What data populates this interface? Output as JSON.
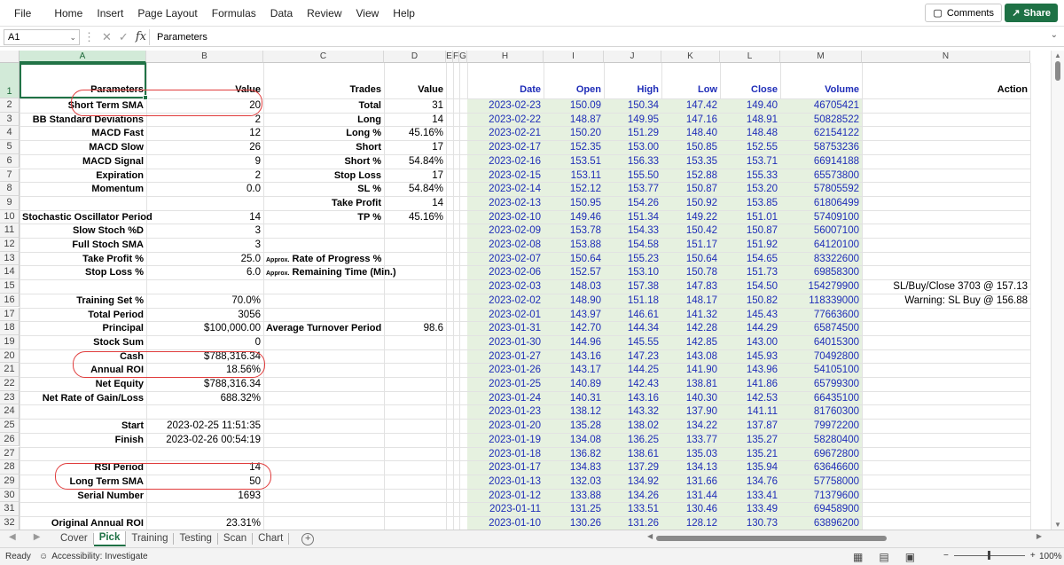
{
  "menu": [
    "File",
    "Home",
    "Insert",
    "Page Layout",
    "Formulas",
    "Data",
    "Review",
    "View",
    "Help"
  ],
  "comments_label": "Comments",
  "share_label": "Share",
  "formula_bar": {
    "name_box": "A1",
    "formula": "Parameters"
  },
  "columns": [
    "A",
    "B",
    "C",
    "D",
    "E",
    "F",
    "G",
    "H",
    "I",
    "J",
    "K",
    "L",
    "M",
    "N"
  ],
  "row_numbers": [
    "1",
    "2",
    "3",
    "4",
    "5",
    "6",
    "7",
    "8",
    "9",
    "10",
    "11",
    "12",
    "13",
    "14",
    "15",
    "16",
    "17",
    "18",
    "19",
    "20",
    "21",
    "22",
    "23",
    "24",
    "25",
    "26",
    "27",
    "28",
    "29",
    "30",
    "31",
    "32"
  ],
  "headers": {
    "parameters": "Parameters",
    "value": "Value",
    "trades": "Trades",
    "value2": "Value",
    "date": "Date",
    "open": "Open",
    "high": "High",
    "low": "Low",
    "close": "Close",
    "volume": "Volume",
    "action": "Action"
  },
  "params_a": [
    {
      "row": 2,
      "label": "Short Term SMA",
      "value": "20"
    },
    {
      "row": 3,
      "label": "BB Standard Deviations",
      "value": "2"
    },
    {
      "row": 4,
      "label": "MACD Fast",
      "value": "12"
    },
    {
      "row": 5,
      "label": "MACD Slow",
      "value": "26"
    },
    {
      "row": 6,
      "label": "MACD Signal",
      "value": "9"
    },
    {
      "row": 7,
      "label": "Expiration",
      "value": "2"
    },
    {
      "row": 8,
      "label": "Momentum",
      "value": "0.0"
    },
    {
      "row": 10,
      "label": "Stochastic Oscillator Period",
      "value": "14"
    },
    {
      "row": 11,
      "label": "Slow Stoch %D",
      "value": "3"
    },
    {
      "row": 12,
      "label": "Full Stoch SMA",
      "value": "3"
    },
    {
      "row": 13,
      "label": "Take Profit %",
      "value": "25.0"
    },
    {
      "row": 14,
      "label": "Stop Loss %",
      "value": "6.0"
    },
    {
      "row": 16,
      "label": "Training Set %",
      "value": "70.0%"
    },
    {
      "row": 17,
      "label": "Total Period",
      "value": "3056"
    },
    {
      "row": 18,
      "label": "Principal",
      "value": "$100,000.00"
    },
    {
      "row": 19,
      "label": "Stock Sum",
      "value": "0"
    },
    {
      "row": 20,
      "label": "Cash",
      "value": "$788,316.34"
    },
    {
      "row": 21,
      "label": "Annual ROI",
      "value": "18.56%"
    },
    {
      "row": 22,
      "label": "Net Equity",
      "value": "$788,316.34"
    },
    {
      "row": 23,
      "label": "Net Rate of Gain/Loss",
      "value": "688.32%"
    },
    {
      "row": 25,
      "label": "Start",
      "value": "2023-02-25 11:51:35"
    },
    {
      "row": 26,
      "label": "Finish",
      "value": "2023-02-26 00:54:19"
    },
    {
      "row": 28,
      "label": "RSI Period",
      "value": "14"
    },
    {
      "row": 29,
      "label": "Long Term SMA",
      "value": "50"
    },
    {
      "row": 30,
      "label": "Serial Number",
      "value": "1693"
    },
    {
      "row": 32,
      "label": "Original Annual ROI",
      "value": "23.31%"
    }
  ],
  "trades": [
    {
      "row": 2,
      "label": "Total",
      "value": "31"
    },
    {
      "row": 3,
      "label": "Long",
      "value": "14"
    },
    {
      "row": 4,
      "label": "Long %",
      "value": "45.16%"
    },
    {
      "row": 5,
      "label": "Short",
      "value": "17"
    },
    {
      "row": 6,
      "label": "Short %",
      "value": "54.84%"
    },
    {
      "row": 7,
      "label": "Stop Loss",
      "value": "17"
    },
    {
      "row": 8,
      "label": "SL %",
      "value": "54.84%"
    },
    {
      "row": 9,
      "label": "Take Profit",
      "value": "14"
    },
    {
      "row": 10,
      "label": "TP %",
      "value": "45.16%"
    },
    {
      "row": 18,
      "label": "Average Turnover Period",
      "value": "98.6"
    }
  ],
  "progress_labels": {
    "approx1": "Approx.",
    "rate": "Rate of Progress %",
    "approx2": "Approx.",
    "remaining": "Remaining Time (Min.)"
  },
  "prices": [
    [
      "2023-02-23",
      "150.09",
      "150.34",
      "147.42",
      "149.40",
      "46705421"
    ],
    [
      "2023-02-22",
      "148.87",
      "149.95",
      "147.16",
      "148.91",
      "50828522"
    ],
    [
      "2023-02-21",
      "150.20",
      "151.29",
      "148.40",
      "148.48",
      "62154122"
    ],
    [
      "2023-02-17",
      "152.35",
      "153.00",
      "150.85",
      "152.55",
      "58753236"
    ],
    [
      "2023-02-16",
      "153.51",
      "156.33",
      "153.35",
      "153.71",
      "66914188"
    ],
    [
      "2023-02-15",
      "153.11",
      "155.50",
      "152.88",
      "155.33",
      "65573800"
    ],
    [
      "2023-02-14",
      "152.12",
      "153.77",
      "150.87",
      "153.20",
      "57805592"
    ],
    [
      "2023-02-13",
      "150.95",
      "154.26",
      "150.92",
      "153.85",
      "61806499"
    ],
    [
      "2023-02-10",
      "149.46",
      "151.34",
      "149.22",
      "151.01",
      "57409100"
    ],
    [
      "2023-02-09",
      "153.78",
      "154.33",
      "150.42",
      "150.87",
      "56007100"
    ],
    [
      "2023-02-08",
      "153.88",
      "154.58",
      "151.17",
      "151.92",
      "64120100"
    ],
    [
      "2023-02-07",
      "150.64",
      "155.23",
      "150.64",
      "154.65",
      "83322600"
    ],
    [
      "2023-02-06",
      "152.57",
      "153.10",
      "150.78",
      "151.73",
      "69858300"
    ],
    [
      "2023-02-03",
      "148.03",
      "157.38",
      "147.83",
      "154.50",
      "154279900"
    ],
    [
      "2023-02-02",
      "148.90",
      "151.18",
      "148.17",
      "150.82",
      "118339000"
    ],
    [
      "2023-02-01",
      "143.97",
      "146.61",
      "141.32",
      "145.43",
      "77663600"
    ],
    [
      "2023-01-31",
      "142.70",
      "144.34",
      "142.28",
      "144.29",
      "65874500"
    ],
    [
      "2023-01-30",
      "144.96",
      "145.55",
      "142.85",
      "143.00",
      "64015300"
    ],
    [
      "2023-01-27",
      "143.16",
      "147.23",
      "143.08",
      "145.93",
      "70492800"
    ],
    [
      "2023-01-26",
      "143.17",
      "144.25",
      "141.90",
      "143.96",
      "54105100"
    ],
    [
      "2023-01-25",
      "140.89",
      "142.43",
      "138.81",
      "141.86",
      "65799300"
    ],
    [
      "2023-01-24",
      "140.31",
      "143.16",
      "140.30",
      "142.53",
      "66435100"
    ],
    [
      "2023-01-23",
      "138.12",
      "143.32",
      "137.90",
      "141.11",
      "81760300"
    ],
    [
      "2023-01-20",
      "135.28",
      "138.02",
      "134.22",
      "137.87",
      "79972200"
    ],
    [
      "2023-01-19",
      "134.08",
      "136.25",
      "133.77",
      "135.27",
      "58280400"
    ],
    [
      "2023-01-18",
      "136.82",
      "138.61",
      "135.03",
      "135.21",
      "69672800"
    ],
    [
      "2023-01-17",
      "134.83",
      "137.29",
      "134.13",
      "135.94",
      "63646600"
    ],
    [
      "2023-01-13",
      "132.03",
      "134.92",
      "131.66",
      "134.76",
      "57758000"
    ],
    [
      "2023-01-12",
      "133.88",
      "134.26",
      "131.44",
      "133.41",
      "71379600"
    ],
    [
      "2023-01-11",
      "131.25",
      "133.51",
      "130.46",
      "133.49",
      "69458900"
    ],
    [
      "2023-01-10",
      "130.26",
      "131.26",
      "128.12",
      "130.73",
      "63896200"
    ]
  ],
  "actions": [
    {
      "row": 15,
      "text": "SL/Buy/Close 3703 @ 157.13"
    },
    {
      "row": 16,
      "text": "Warning: SL Buy @ 156.88"
    }
  ],
  "sheet_tabs": [
    "Cover",
    "Pick",
    "Training",
    "Testing",
    "Scan",
    "Chart"
  ],
  "active_tab": "Pick",
  "status": {
    "ready": "Ready",
    "accessibility": "Accessibility: Investigate",
    "zoom": "100%"
  }
}
